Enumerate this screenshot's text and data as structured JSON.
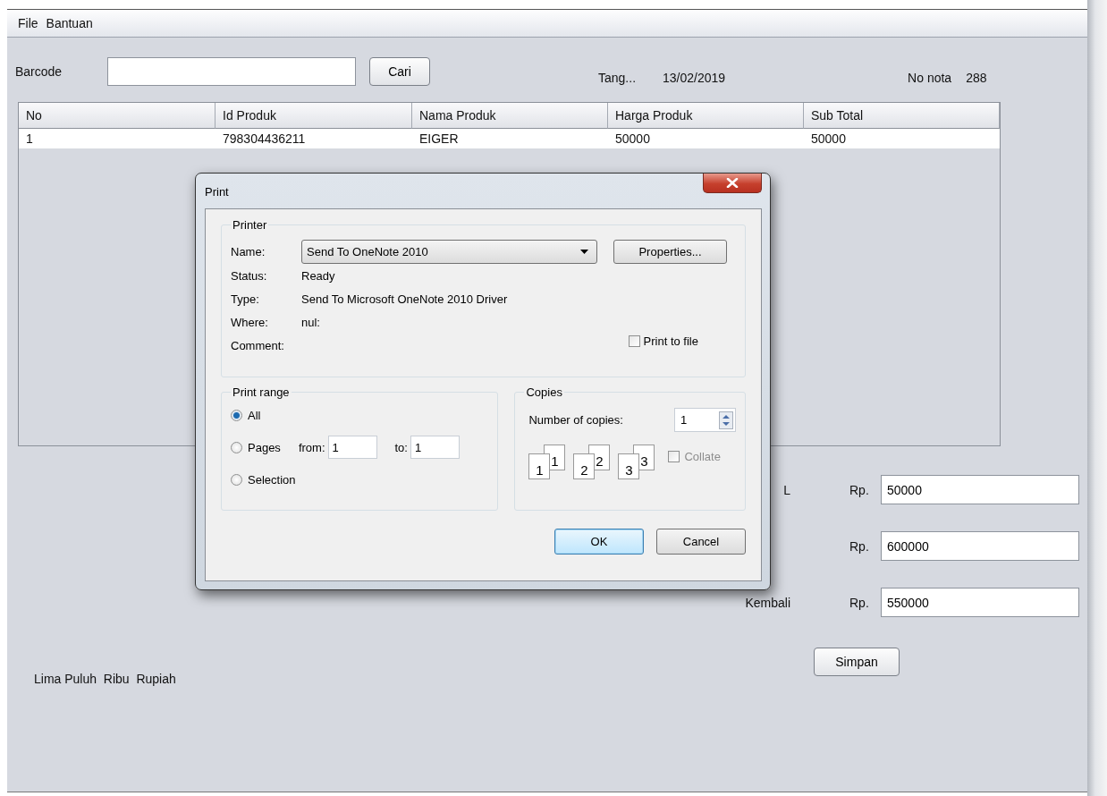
{
  "menu": [
    {
      "label": "File"
    },
    {
      "label": "Bantuan"
    }
  ],
  "barcode": {
    "label": "Barcode",
    "button": "Cari"
  },
  "date": {
    "label": "Tang...",
    "value": "13/02/2019"
  },
  "invoice": {
    "label": "No nota",
    "value": "288"
  },
  "table": {
    "columns": [
      "No",
      "Id Produk",
      "Nama Produk",
      "Harga Produk",
      "Sub Total"
    ],
    "rows": [
      [
        "1",
        "798304436211",
        "EIGER",
        "50000",
        "50000"
      ]
    ]
  },
  "summary": [
    {
      "label": "L",
      "currency": "Rp.",
      "value": "50000"
    },
    {
      "currency": "Rp.",
      "value": "600000"
    },
    {
      "label": "Kembali",
      "currency": "Rp.",
      "value": "550000"
    }
  ],
  "save_button": "Simpan",
  "amount_in_words": "Lima Puluh  Ribu  Rupiah",
  "dialog": {
    "title": "Print",
    "printer": {
      "title": "Printer",
      "name_label": "Name:",
      "name_value": "Send To OneNote 2010",
      "properties_button": "Properties...",
      "info": [
        {
          "label": "Status:",
          "value": "Ready"
        },
        {
          "label": "Type:",
          "value": "Send To Microsoft OneNote 2010 Driver"
        },
        {
          "label": "Where:",
          "value": "nul:"
        },
        {
          "label": "Comment:"
        }
      ],
      "print_to_file": {
        "label": "Print to file",
        "checked": false
      }
    },
    "print_range": {
      "title": "Print range",
      "options": [
        {
          "label": "All",
          "selected": true
        },
        {
          "label": "Pages",
          "selected": false
        },
        {
          "label": "Selection",
          "selected": false
        }
      ],
      "from_label": "from:",
      "from_value": "1",
      "to_label": "to:",
      "to_value": "1"
    },
    "copies": {
      "title": "Copies",
      "number_label": "Number of copies:",
      "number_value": "1",
      "pages": [
        {
          "front": "1",
          "back": "1"
        },
        {
          "front": "2",
          "back": "2"
        },
        {
          "front": "3",
          "back": "3"
        }
      ],
      "collate": {
        "label": "Collate",
        "checked": false,
        "disabled": true
      }
    },
    "buttons": [
      {
        "label": "OK",
        "default": true
      },
      {
        "label": "Cancel",
        "default": false
      }
    ]
  }
}
